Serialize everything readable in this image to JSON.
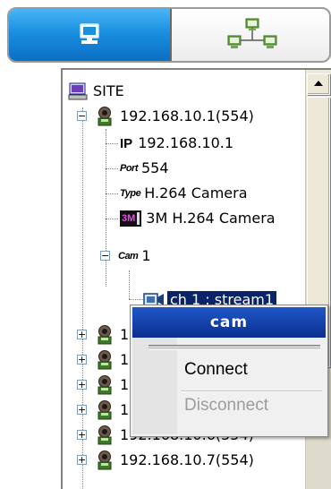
{
  "tabs": {
    "computer_icon": "computer-icon",
    "network_icon": "network-icon"
  },
  "tree": {
    "root": {
      "label": "SITE",
      "icon": "computer-icon"
    },
    "device1": {
      "label": "192.168.10.1(554)",
      "ip_label": "IP",
      "ip_value": "192.168.10.1",
      "port_label": "Port",
      "port_value": "554",
      "type_label": "Type",
      "type_value": "H.264 Camera",
      "model_badge": "3M",
      "model_value": "3M H.264 Camera",
      "cam_label": "Cam",
      "cam_value": "1",
      "channel_label": "ch 1 : stream1"
    },
    "collapsed_devices": [
      {
        "label": "192"
      },
      {
        "label": "192"
      },
      {
        "label": "192"
      },
      {
        "label": "192"
      },
      {
        "label": "192.168.10.6(554)"
      },
      {
        "label": "192.168.10.7(554)"
      }
    ]
  },
  "context_menu": {
    "title": "cam",
    "items": [
      {
        "label": "Connect",
        "enabled": true
      },
      {
        "label": "Disconnect",
        "enabled": false
      }
    ]
  },
  "colors": {
    "tab_active": "#1a8fe0",
    "selection": "#0a246a",
    "menu_header": "#0b2f8f",
    "disabled_text": "#9c9c9c"
  }
}
